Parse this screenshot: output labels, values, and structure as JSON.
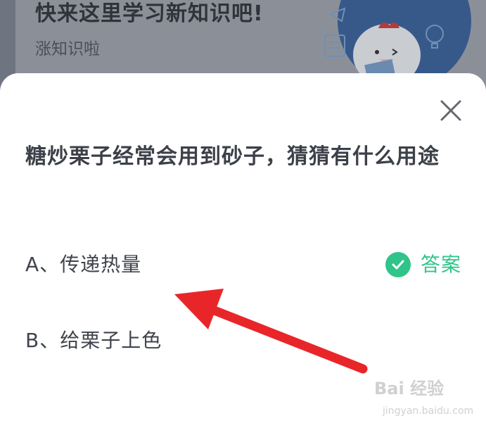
{
  "background_card": {
    "title": "快来这里学习新知识吧!",
    "subtitle": "涨知识啦"
  },
  "dialog": {
    "question": "糖炒栗子经常会用到砂子，猜猜有什么用途",
    "options": [
      {
        "label": "A、传递热量",
        "is_answer": true
      },
      {
        "label": "B、给栗子上色",
        "is_answer": false
      }
    ],
    "answer_label": "答案",
    "close_icon": "close-icon"
  },
  "annotation": {
    "arrow_color": "#e8262a"
  },
  "colors": {
    "answer_green": "#2fc48a",
    "question_text": "#3c4049",
    "overlay": "#6f7580"
  },
  "watermark": {
    "main": "Bai 经验",
    "sub": "jingyan.baidu.com"
  }
}
